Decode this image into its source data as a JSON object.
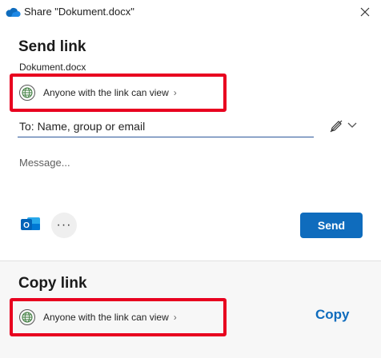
{
  "window": {
    "title": "Share \"Dokument.docx\""
  },
  "send": {
    "heading": "Send link",
    "filename": "Dokument.docx",
    "link_setting": "Anyone with the link can view",
    "to_placeholder": "To: Name, group or email",
    "message_placeholder": "Message...",
    "send_label": "Send",
    "more_label": "···"
  },
  "copy": {
    "heading": "Copy link",
    "link_setting": "Anyone with the link can view",
    "copy_label": "Copy"
  },
  "colors": {
    "accent": "#0f6cbd",
    "highlight": "#e8001f"
  }
}
